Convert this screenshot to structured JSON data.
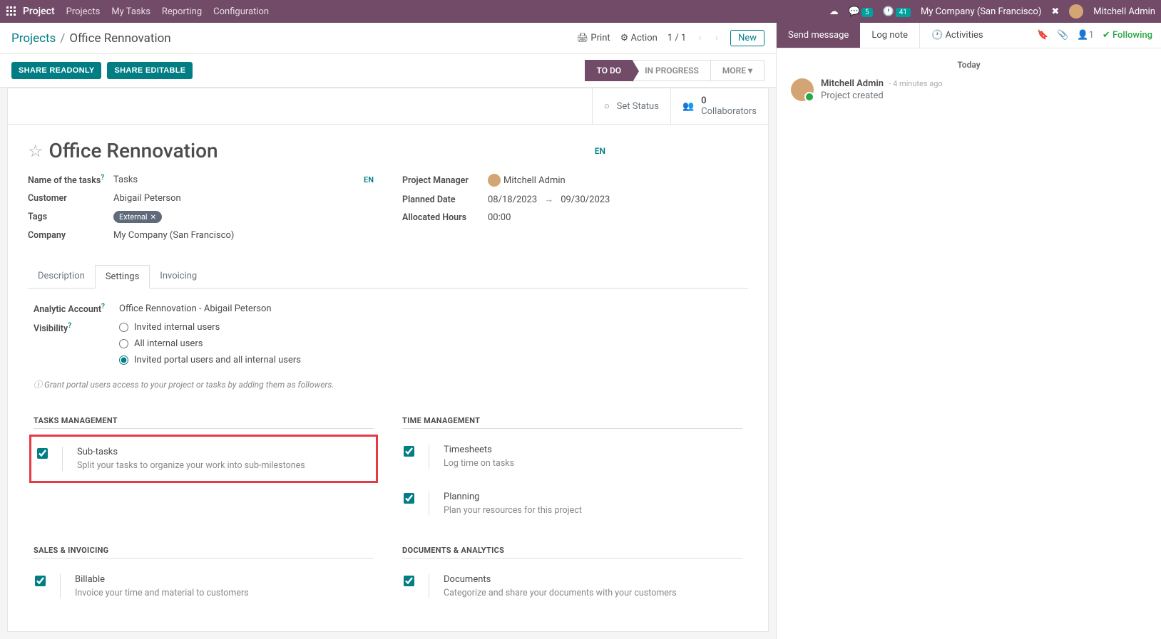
{
  "topbar": {
    "brand": "Project",
    "nav": [
      "Projects",
      "My Tasks",
      "Reporting",
      "Configuration"
    ],
    "chat_badge": "5",
    "clock_badge": "41",
    "company": "My Company (San Francisco)",
    "user": "Mitchell Admin"
  },
  "breadcrumb": {
    "root": "Projects",
    "current": "Office Rennovation",
    "print": "Print",
    "action": "Action",
    "pager": "1 / 1",
    "new": "New"
  },
  "actions": {
    "share_readonly": "SHARE READONLY",
    "share_editable": "SHARE EDITABLE",
    "stages": {
      "todo": "TO DO",
      "in_progress": "IN PROGRESS",
      "more": "MORE"
    }
  },
  "statusbar": {
    "set_status": "Set Status",
    "collab_count": "0",
    "collab_label": "Collaborators"
  },
  "title": {
    "name": "Office Rennovation",
    "lang": "EN"
  },
  "fields": {
    "name_of_tasks_label": "Name of the tasks",
    "name_of_tasks_value": "Tasks",
    "name_lang": "EN",
    "customer_label": "Customer",
    "customer_value": "Abigail Peterson",
    "tags_label": "Tags",
    "tag_value": "External",
    "company_label": "Company",
    "company_value": "My Company (San Francisco)",
    "pm_label": "Project Manager",
    "pm_value": "Mitchell Admin",
    "planned_label": "Planned Date",
    "planned_start": "08/18/2023",
    "planned_end": "09/30/2023",
    "hours_label": "Allocated Hours",
    "hours_value": "00:00"
  },
  "tabs": {
    "description": "Description",
    "settings": "Settings",
    "invoicing": "Invoicing"
  },
  "settings": {
    "analytic_label": "Analytic Account",
    "analytic_value": "Office Rennovation - Abigail Peterson",
    "visibility_label": "Visibility",
    "vis_opt1": "Invited internal users",
    "vis_opt2": "All internal users",
    "vis_opt3": "Invited portal users and all internal users",
    "hint": "Grant portal users access to your project or tasks by adding them as followers.",
    "tasks_mgmt": "TASKS MANAGEMENT",
    "time_mgmt": "TIME MANAGEMENT",
    "sales_inv": "SALES & INVOICING",
    "docs_analytics": "DOCUMENTS & ANALYTICS",
    "subtasks_title": "Sub-tasks",
    "subtasks_desc": "Split your tasks to organize your work into sub-milestones",
    "timesheets_title": "Timesheets",
    "timesheets_desc": "Log time on tasks",
    "planning_title": "Planning",
    "planning_desc": "Plan your resources for this project",
    "billable_title": "Billable",
    "billable_desc": "Invoice your time and material to customers",
    "documents_title": "Documents",
    "documents_desc": "Categorize and share your documents with your customers"
  },
  "chatter": {
    "send": "Send message",
    "log": "Log note",
    "activities": "Activities",
    "followers": "1",
    "following": "Following",
    "today": "Today",
    "msg_author": "Mitchell Admin",
    "msg_time": "- 4 minutes ago",
    "msg_text": "Project created"
  }
}
